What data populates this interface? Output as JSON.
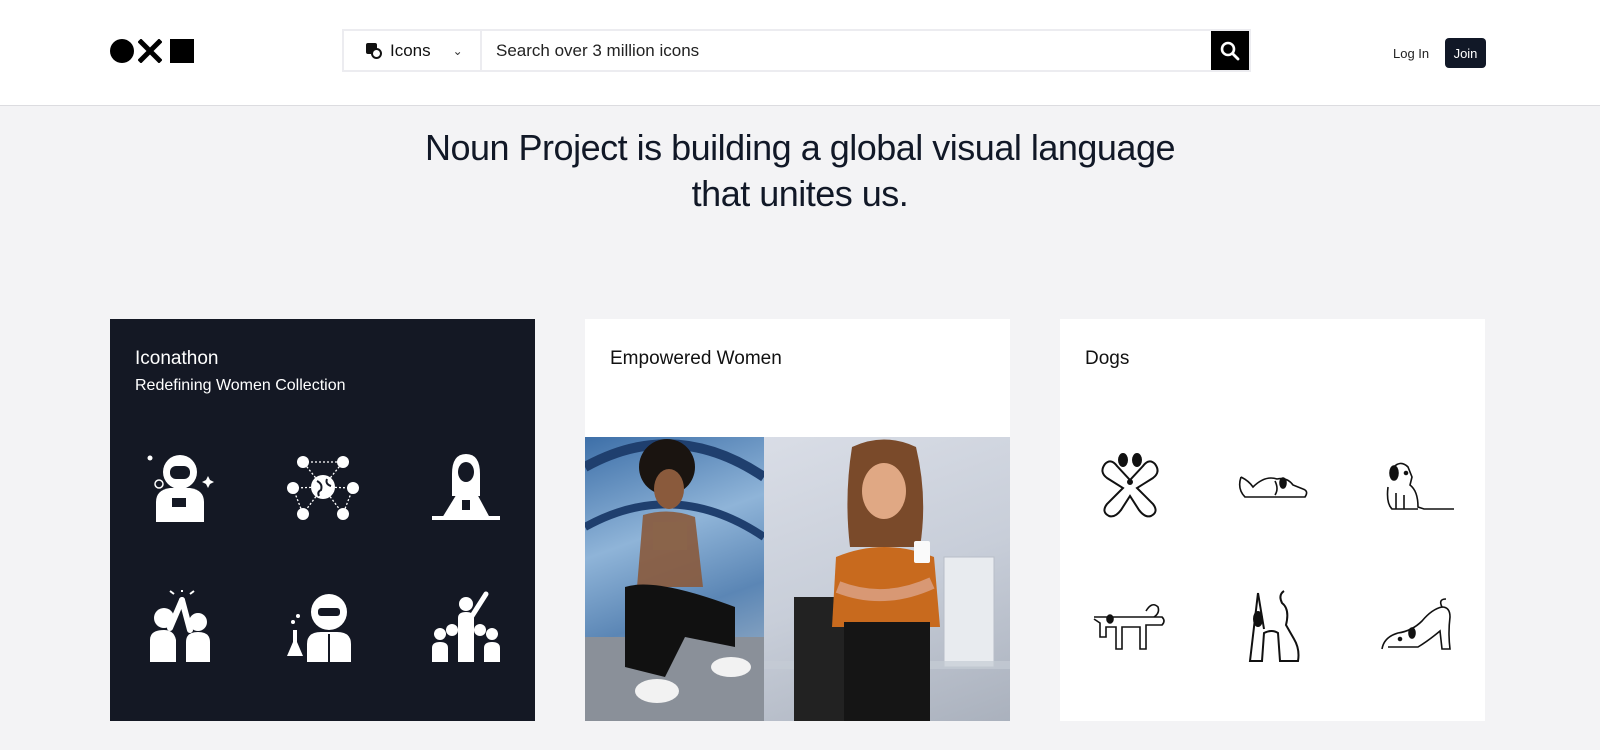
{
  "brand": {
    "logo": "Noun Project",
    "colors": {
      "dark": "#111827",
      "card_dark": "#141824",
      "background": "#f3f3f5"
    }
  },
  "search": {
    "type_label": "Icons",
    "placeholder": "Search over 3 million icons",
    "type_icon": "collection-icon",
    "submit_icon": "search-icon"
  },
  "auth": {
    "login_label": "Log In",
    "join_label": "Join"
  },
  "hero": {
    "line1": "Noun Project is building a global visual language",
    "line2": "that unites us."
  },
  "cards": [
    {
      "title": "Iconathon",
      "subtitle": "Redefining Women Collection",
      "icons": [
        "astronaut-icon",
        "global-network-icon",
        "woman-hijab-laptop-icon",
        "high-five-icon",
        "scientist-icon",
        "leader-crowd-icon"
      ]
    },
    {
      "title": "Empowered Women",
      "photos": [
        "woman-crouching-photo",
        "woman-holding-mug-photo"
      ]
    },
    {
      "title": "Dogs",
      "icons": [
        "dog-playing-icon",
        "dog-lying-icon",
        "dog-sitting-icon",
        "dog-stretching-left-icon",
        "dog-howling-icon",
        "dog-stretching-icon"
      ]
    }
  ]
}
